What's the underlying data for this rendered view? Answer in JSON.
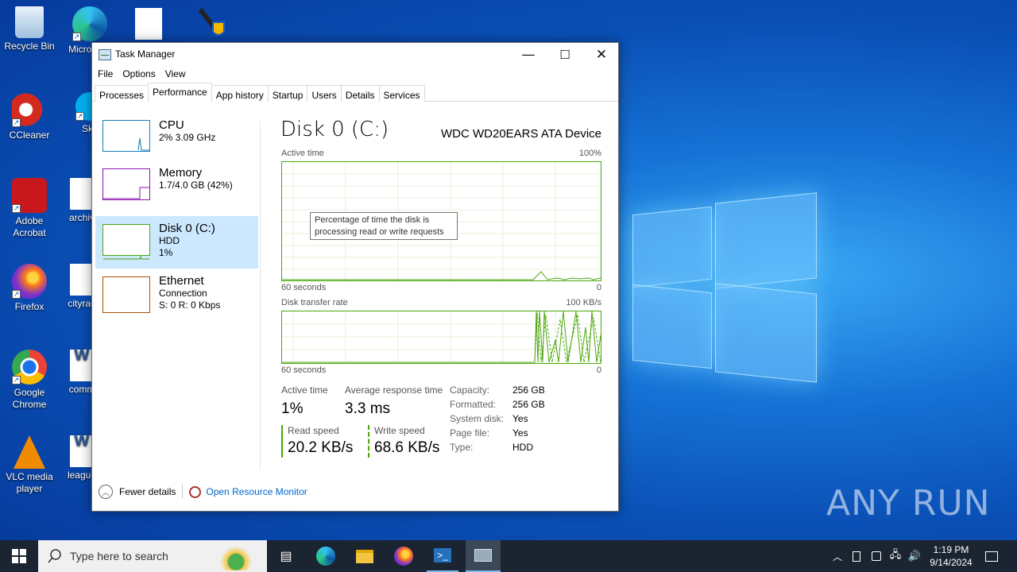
{
  "desktop": {
    "icons": [
      {
        "label": "Recycle Bin",
        "icon": "recycle-bin-icon"
      },
      {
        "label": "Micro Edg",
        "icon": "edge-icon"
      },
      {
        "label": "CCleaner",
        "icon": "ccleaner-icon"
      },
      {
        "label": "Sky",
        "icon": "skype-icon"
      },
      {
        "label": "Adobe Acrobat",
        "icon": "acrobat-icon"
      },
      {
        "label": "archiv",
        "icon": "image-file-icon"
      },
      {
        "label": "Firefox",
        "icon": "firefox-icon"
      },
      {
        "label": "cityrad",
        "icon": "image-file-icon"
      },
      {
        "label": "Google Chrome",
        "icon": "chrome-icon"
      },
      {
        "label": "comm",
        "icon": "word-doc-icon"
      },
      {
        "label": "VLC media player",
        "icon": "vlc-icon"
      },
      {
        "label": "league",
        "icon": "word-doc-icon"
      }
    ],
    "watermark": "ANY RUN"
  },
  "window": {
    "title": "Task Manager",
    "menu": [
      "File",
      "Options",
      "View"
    ],
    "tabs": [
      "Processes",
      "Performance",
      "App history",
      "Startup",
      "Users",
      "Details",
      "Services"
    ],
    "active_tab": "Performance"
  },
  "sidebar": {
    "items": [
      {
        "name": "CPU",
        "sub1": "2% 3.09 GHz",
        "sub2": "",
        "sub3": "",
        "color": "#117dbb"
      },
      {
        "name": "Memory",
        "sub1": "1.7/4.0 GB (42%)",
        "sub2": "",
        "sub3": "",
        "color": "#8b12ae"
      },
      {
        "name": "Disk 0 (C:)",
        "sub1": "HDD",
        "sub2": "1%",
        "sub3": "",
        "color": "#4da60c"
      },
      {
        "name": "Ethernet",
        "sub1": "Connection",
        "sub2": "S: 0 R: 0 Kbps",
        "sub3": "",
        "color": "#a74f01"
      }
    ],
    "selected": "Disk 0 (C:)"
  },
  "main": {
    "title": "Disk 0 (C:)",
    "model": "WDC WD20EARS ATA Device",
    "active_time_label": "Active time",
    "active_time_max": "100%",
    "graph_time_label": "60 seconds",
    "graph_zero": "0",
    "transfer_label": "Disk transfer rate",
    "transfer_max": "100 KB/s",
    "tooltip_line1": "Percentage of time the disk is",
    "tooltip_line2": "processing read or write requests",
    "stats": {
      "active_time_label": "Active time",
      "active_time_value": "1%",
      "avg_resp_label": "Average response time",
      "avg_resp_value": "3.3 ms",
      "read_label": "Read speed",
      "read_value": "20.2 KB/s",
      "write_label": "Write speed",
      "write_value": "68.6 KB/s"
    },
    "info": [
      {
        "k": "Capacity:",
        "v": "256 GB"
      },
      {
        "k": "Formatted:",
        "v": "256 GB"
      },
      {
        "k": "System disk:",
        "v": "Yes"
      },
      {
        "k": "Page file:",
        "v": "Yes"
      },
      {
        "k": "Type:",
        "v": "HDD"
      }
    ]
  },
  "footer": {
    "fewer_details": "Fewer details",
    "open_resource_monitor": "Open Resource Monitor"
  },
  "taskbar": {
    "search_placeholder": "Type here to search",
    "time": "1:19 PM",
    "date": "9/14/2024"
  },
  "colors": {
    "accent_green": "#4da60c",
    "link": "#0066cc",
    "selection": "#cce8ff"
  }
}
